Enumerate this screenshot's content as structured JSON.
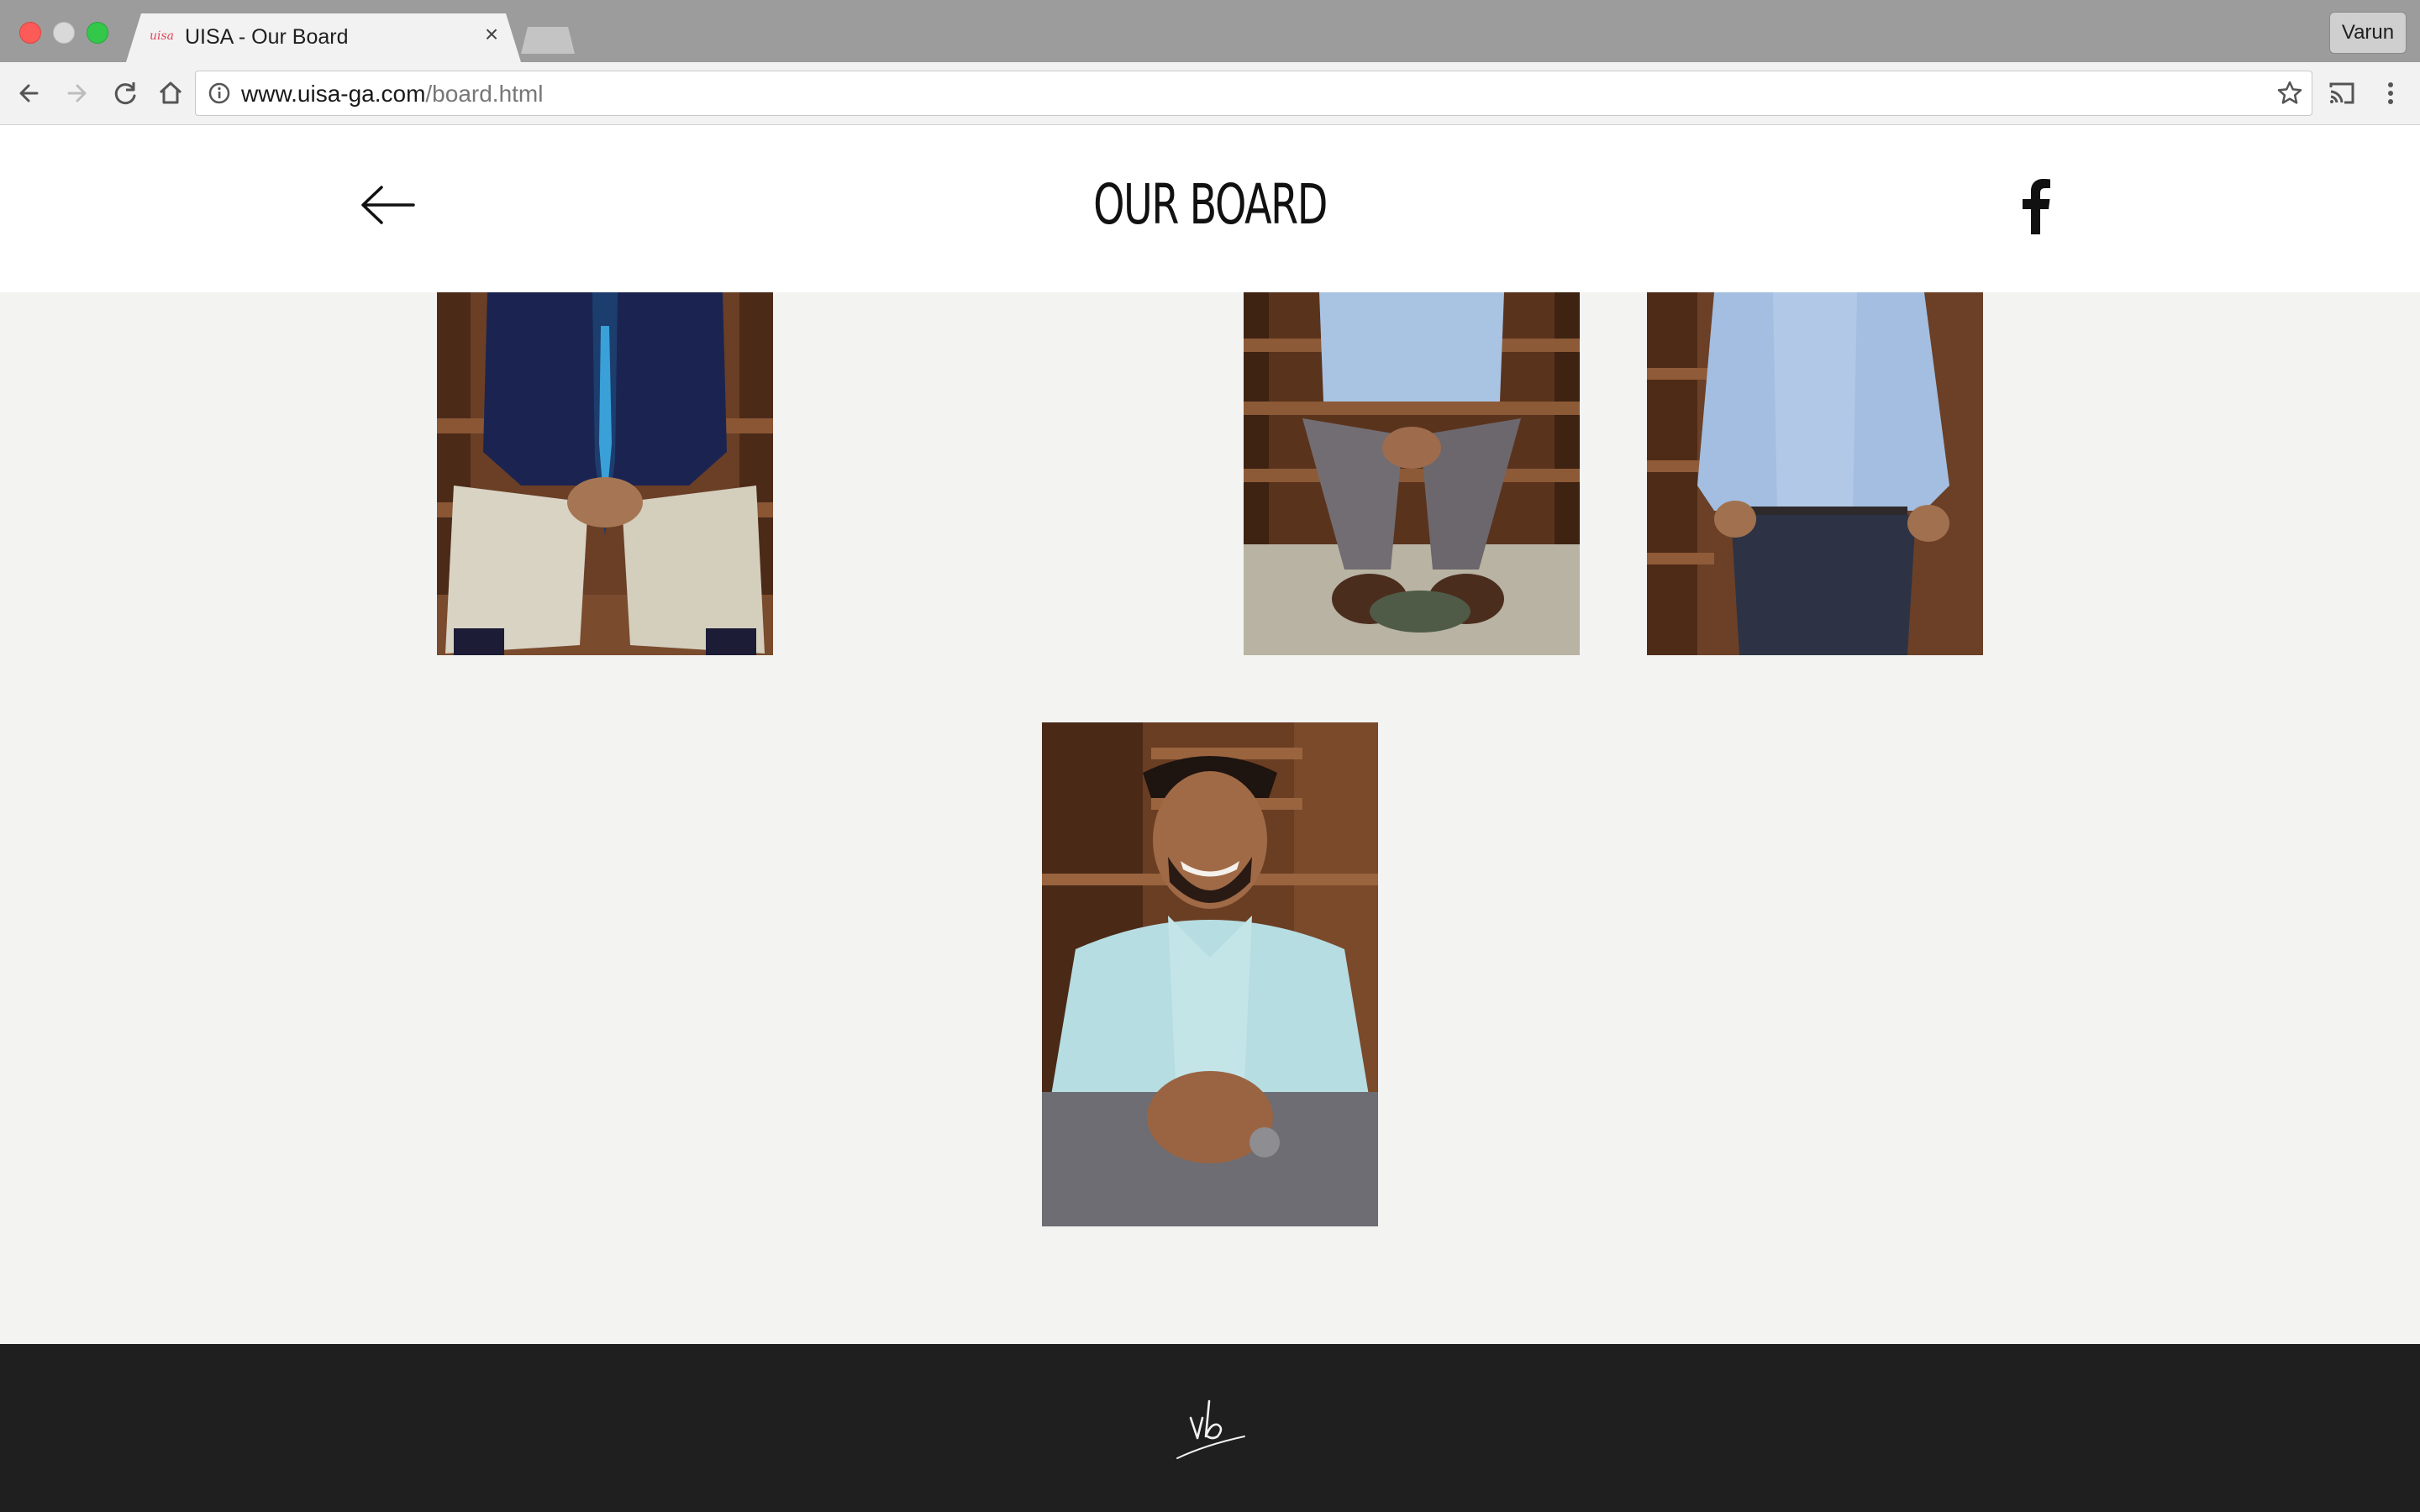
{
  "browser": {
    "tab_title": "UISA - Our Board",
    "tab_favicon": "uisa",
    "tab_close": "×",
    "profile_name": "Varun",
    "url_host": "www.uisa-ga.com",
    "url_path": "/board.html",
    "icons": [
      "back-icon",
      "forward-icon",
      "reload-icon",
      "home-icon",
      "info-icon",
      "star-icon",
      "cast-icon",
      "menu-icon"
    ]
  },
  "page": {
    "title": "OUR BOARD",
    "back_icon": "arrow-left-icon",
    "social_icon": "facebook-icon",
    "photos": [
      {
        "alt": "board member in navy shirt and tie seated on wooden steps"
      },
      {
        "alt": "board member in light blue shirt seated on wooden steps"
      },
      {
        "alt": "board member in light blue shirt standing by wooden steps"
      },
      {
        "alt": "board member smiling in light blue shirt seated on wooden steps"
      }
    ],
    "footer_logo": "vb"
  },
  "colors": {
    "page_bg": "#f3f3f2",
    "header_bg": "#ffffff",
    "footer_bg": "#1f1f1f",
    "wood": "#6b4128"
  }
}
